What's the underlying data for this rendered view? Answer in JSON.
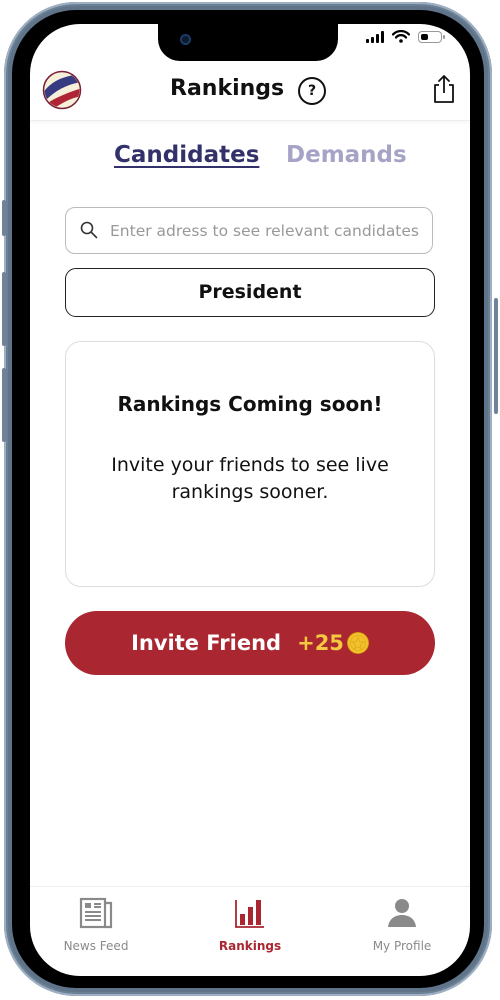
{
  "status_bar": {
    "icons": [
      "cellular-signal-icon",
      "wifi-icon",
      "battery-icon"
    ],
    "battery_level": 0.4
  },
  "header": {
    "logo": "app-logo",
    "title": "Rankings",
    "help_label": "?",
    "share_icon": "share-icon"
  },
  "tabs": [
    {
      "label": "Candidates",
      "active": true
    },
    {
      "label": "Demands",
      "active": false
    }
  ],
  "search": {
    "placeholder": "Enter adress to see relevant candidates",
    "value": "",
    "icon": "search-icon"
  },
  "office_selector": {
    "value": "President"
  },
  "notice_card": {
    "title": "Rankings Coming soon!",
    "body": "Invite your friends to see live rankings sooner."
  },
  "invite_button": {
    "label": "Invite Friend",
    "reward": "+25",
    "reward_icon": "coin-icon"
  },
  "bottom_nav": {
    "items": [
      {
        "label": "News Feed",
        "icon": "newspaper-icon",
        "active": false
      },
      {
        "label": "Rankings",
        "icon": "bar-chart-icon",
        "active": true
      },
      {
        "label": "My Profile",
        "icon": "person-icon",
        "active": false
      }
    ]
  },
  "colors": {
    "brand_red": "#aa2630",
    "brand_navy": "#33316a",
    "inactive_tab": "#a5a4c7",
    "reward_gold": "#f5c842",
    "nav_inactive": "#8a8a8a"
  }
}
